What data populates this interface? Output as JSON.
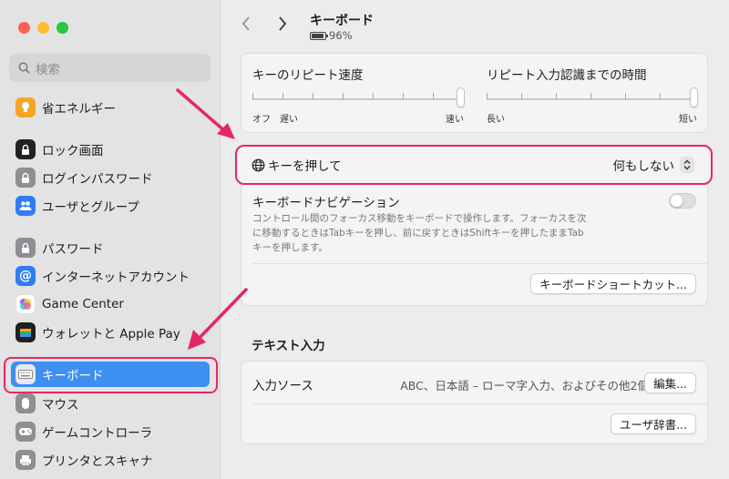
{
  "sidebar": {
    "search_placeholder": "検索",
    "items": [
      {
        "label": "省エネルギー",
        "icon": "lightbulb-icon",
        "color": "#f5a524"
      },
      {
        "label": "ロック画面",
        "icon": "lock-screen-icon",
        "color": "#222222"
      },
      {
        "label": "ログインパスワード",
        "icon": "lock-icon",
        "color": "#8e8e93"
      },
      {
        "label": "ユーザとグループ",
        "icon": "users-icon",
        "color": "#2f7cf6"
      },
      {
        "label": "パスワード",
        "icon": "key-icon",
        "color": "#8e8e93"
      },
      {
        "label": "インターネットアカウント",
        "icon": "at-icon",
        "color": "#2f7cf6"
      },
      {
        "label": "Game Center",
        "icon": "game-center-icon",
        "color": "#ffffff"
      },
      {
        "label": "ウォレットと Apple Pay",
        "icon": "wallet-icon",
        "color": "#1f1f1f"
      },
      {
        "label": "キーボード",
        "icon": "keyboard-icon",
        "color": "#8e8e93"
      },
      {
        "label": "マウス",
        "icon": "mouse-icon",
        "color": "#8e8e93"
      },
      {
        "label": "ゲームコントローラ",
        "icon": "gamepad-icon",
        "color": "#8e8e93"
      },
      {
        "label": "プリンタとスキャナ",
        "icon": "printer-icon",
        "color": "#8e8e93"
      }
    ]
  },
  "header": {
    "title": "キーボード",
    "battery": "96%"
  },
  "repeat": {
    "rate_title": "キーのリピート速度",
    "rate_left": "オフ",
    "rate_left2": "遅い",
    "rate_right": "速い",
    "delay_title": "リピート入力認識までの時間",
    "delay_left": "長い",
    "delay_right": "短い",
    "rate_level": 1.0,
    "delay_level": 1.0
  },
  "globe": {
    "label": "キーを押して",
    "value": "何もしない"
  },
  "navigation": {
    "title": "キーボードナビゲーション",
    "desc_line1": "コントロール間のフォーカス移動をキーボードで操作します。フォーカスを次",
    "desc_line2": "に移動するときはTabキーを押し、前に戻すときはShiftキーを押したままTab",
    "desc_line3": "キーを押します。",
    "shortcut_button": "キーボードショートカット..."
  },
  "text_input": {
    "section_title": "テキスト入力",
    "source_label": "入力ソース",
    "source_value": "ABC、日本語 – ローマ字入力、およびその他2個",
    "edit_button": "編集...",
    "dict_button": "ユーザ辞書..."
  },
  "colors": {
    "accent": "#3d8ff2",
    "highlight": "#e6266b"
  }
}
